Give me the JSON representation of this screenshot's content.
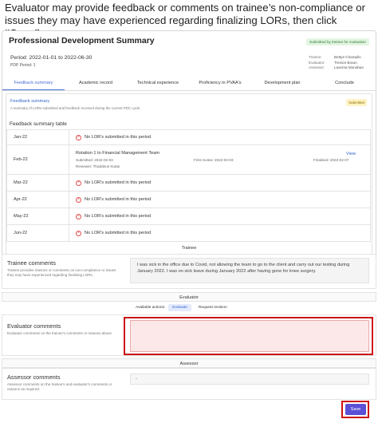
{
  "instruction": {
    "text": "Evaluator may provide feedback or comments on trainee’s non-compliance or issues they may have experienced regarding finalizing LORs, then click ",
    "emphasis": "“Save”"
  },
  "header": {
    "title": "Professional Development Summary",
    "status_badge": "Submitted by trainee for evaluation",
    "period": "Period: 2022-01-01 to 2022-06-30",
    "pdp_number": "PDP Period: 1",
    "people": [
      {
        "role": "Trainee:",
        "name": "Bettye Champlin"
      },
      {
        "role": "Evaluator:",
        "name": "Trevion Braun"
      },
      {
        "role": "Assessor:",
        "name": "Laverna Monahan"
      }
    ]
  },
  "tabs": [
    {
      "label": "Feedback summary",
      "active": true
    },
    {
      "label": "Academic record",
      "active": false
    },
    {
      "label": "Technical experience",
      "active": false
    },
    {
      "label": "Proficiency in PVAA's",
      "active": false
    },
    {
      "label": "Development plan",
      "active": false
    },
    {
      "label": "Conclude",
      "active": false
    }
  ],
  "feedback": {
    "title": "Feedback summary",
    "description": "A summary of LORs submitted and feedback received during the current PDC cycle.",
    "status": "Submitted",
    "table_title": "Feedback summary table",
    "rows": [
      {
        "month": "Jan-22",
        "text": "No LOR's submitted in this period"
      },
      {
        "month": "Feb-22",
        "rotation": "Rotation 1 to Financial Management Team",
        "submitted": "Submitted: 2022-02-03",
        "first_review": "First review: 2022-02-03",
        "finalised": "Finalised: 2022-02-07",
        "reviewer": "Reviewer: Thaddeus Kutas",
        "view": "View"
      },
      {
        "month": "Mar-22",
        "text": "No LOR's submitted in this period"
      },
      {
        "month": "Apr-22",
        "text": "No LOR's submitted in this period"
      },
      {
        "month": "May-22",
        "text": "No LOR's submitted in this period"
      },
      {
        "month": "Jun-22",
        "text": "No LOR's submitted in this period"
      }
    ]
  },
  "trainees": {
    "header": "Trainee",
    "title": "Trainee comments",
    "description": "Trainee provides reasons or comments on non-compliance or issues they may have experienced regarding finalising LORs.",
    "comment": "I was sick in the office due to Covid, not allowing the team to go to the client and carry out our testing during January 2022. I was on sick leave during January 2022 after having gone for knee surgery."
  },
  "evaluator": {
    "header": "Evaluator",
    "available_actions": "Available actions:",
    "action_evaluate": "Evaluate",
    "action_request_revision": "Request revision",
    "title": "Evaluator comments",
    "description": "Evaluator comments on the trainee's comments or reasons above."
  },
  "assessor": {
    "header": "Assessor",
    "title": "Assessor comments",
    "description": "Assessor comments on the trainee's and evaluator's comments or reasons as required.",
    "value": "-"
  },
  "save_label": "Save",
  "colors": {
    "accent": "#4a6fd8",
    "save_button": "#5b4fd6",
    "highlight": "#cc1111",
    "error_icon": "#e05050"
  }
}
